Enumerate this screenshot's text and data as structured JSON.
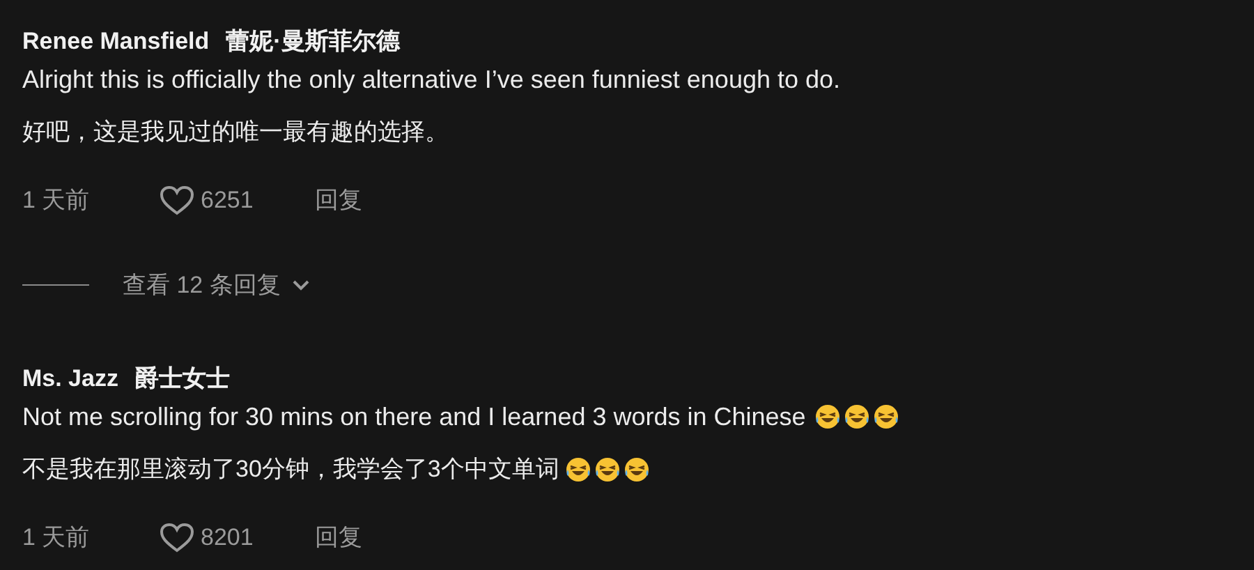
{
  "comments": [
    {
      "author": "Renee Mansfield",
      "author_translation": "蕾妮·曼斯菲尔德",
      "text": "Alright this is officially the only alternative I’ve seen funniest enough to do.",
      "translation": "好吧，这是我见过的唯一最有趣的选择。",
      "time": "1 天前",
      "likes": "6251",
      "liked": false,
      "reply_label": "回复",
      "view_replies": "查看 12 条回复"
    },
    {
      "author": "Ms. Jazz",
      "author_translation": "爵士女士",
      "text": "Not me scrolling for 30 mins on there and I learned 3 words in Chinese",
      "text_emojis": [
        {
          "kind": "tears-of-joy"
        },
        {
          "kind": "tears-of-joy"
        },
        {
          "kind": "tears-of-joy"
        }
      ],
      "translation": "不是我在那里滚动了30分钟，我学会了3个中文单词",
      "translation_emojis": [
        {
          "kind": "tears-of-joy"
        },
        {
          "kind": "tears-of-joy"
        },
        {
          "kind": "tears-of-joy"
        }
      ],
      "time": "1 天前",
      "likes": "8201",
      "liked": false,
      "reply_label": "回复"
    }
  ]
}
